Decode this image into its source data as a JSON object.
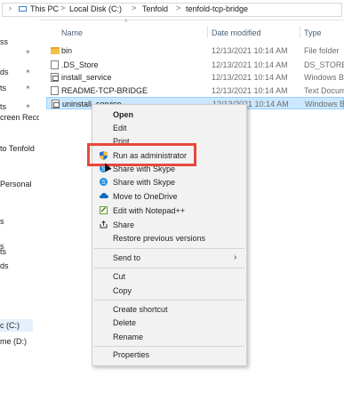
{
  "breadcrumb": {
    "items": [
      "This PC",
      "Local Disk (C:)",
      "Tenfold",
      "tenfold-tcp-bridge"
    ],
    "separator": ">"
  },
  "nav": {
    "items": [
      "ss",
      "ds",
      "ts",
      "ts",
      "creen Reco",
      "to Tenfold",
      "Personal",
      "s",
      "s",
      "ts",
      "ds",
      "c (C:)",
      "me (D:)"
    ],
    "selected_index": 11
  },
  "columns": {
    "name": "Name",
    "date": "Date modified",
    "type": "Type"
  },
  "files": [
    {
      "name": "bin",
      "date": "12/13/2021 10:14 AM",
      "type": "File folder",
      "icon": "folder-icon"
    },
    {
      "name": ".DS_Store",
      "date": "12/13/2021 10:14 AM",
      "type": "DS_STORE F",
      "icon": "file-icon"
    },
    {
      "name": "install_service",
      "date": "12/13/2021 10:14 AM",
      "type": "Windows Ba",
      "icon": "batch-file-icon"
    },
    {
      "name": "README-TCP-BRIDGE",
      "date": "12/13/2021 10:14 AM",
      "type": "Text Docum",
      "icon": "file-icon"
    },
    {
      "name": "uninstall_service",
      "date": "12/13/2021 10:14 AM",
      "type": "Windows Ba",
      "icon": "batch-file-icon",
      "selected": true
    }
  ],
  "context_menu": {
    "items": [
      {
        "label": "Open",
        "bold": true
      },
      {
        "label": "Edit"
      },
      {
        "label": "Print"
      },
      {
        "label": "Run as administrator",
        "icon": "uac-shield-icon",
        "highlighted": true
      },
      {
        "label": "Share with Skype",
        "icon": "skype-icon"
      },
      {
        "label": "Share with Skype",
        "icon": "skype-icon"
      },
      {
        "label": "Move to OneDrive",
        "icon": "onedrive-icon"
      },
      {
        "label": "Edit with Notepad++",
        "icon": "notepadpp-icon"
      },
      {
        "label": "Share",
        "icon": "share-icon"
      },
      {
        "label": "Restore previous versions"
      },
      {
        "label": "Send to",
        "submenu": true
      },
      {
        "label": "Cut"
      },
      {
        "label": "Copy"
      },
      {
        "label": "Create shortcut"
      },
      {
        "label": "Delete"
      },
      {
        "label": "Rename"
      },
      {
        "label": "Properties"
      }
    ]
  },
  "colors": {
    "highlight_box": "#e8473f",
    "selection": "#cce8ff",
    "menu_bg": "#f2f2f2"
  }
}
